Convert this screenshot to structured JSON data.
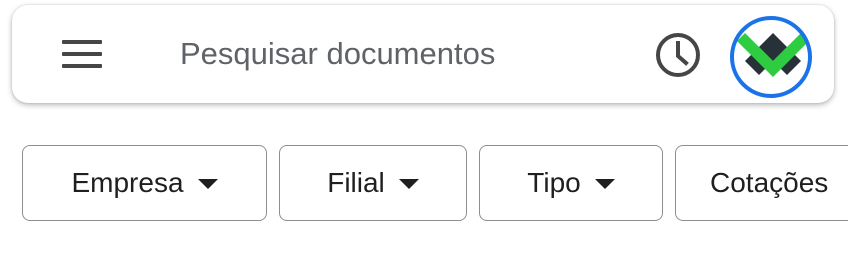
{
  "search": {
    "placeholder": "Pesquisar documentos",
    "menu_icon": "hamburger-menu-icon",
    "history_icon": "history-clock-icon",
    "avatar_icon": "user-avatar-logo"
  },
  "filters": [
    {
      "label": "Empresa",
      "icon": "dropdown-arrow-icon"
    },
    {
      "label": "Filial",
      "icon": "dropdown-arrow-icon"
    },
    {
      "label": "Tipo",
      "icon": "dropdown-arrow-icon"
    },
    {
      "label": "Cotações"
    }
  ],
  "colors": {
    "avatar_ring": "#1a73e8",
    "avatar_green": "#2ecc40",
    "avatar_dark": "#263238",
    "icon_gray": "#444746"
  }
}
